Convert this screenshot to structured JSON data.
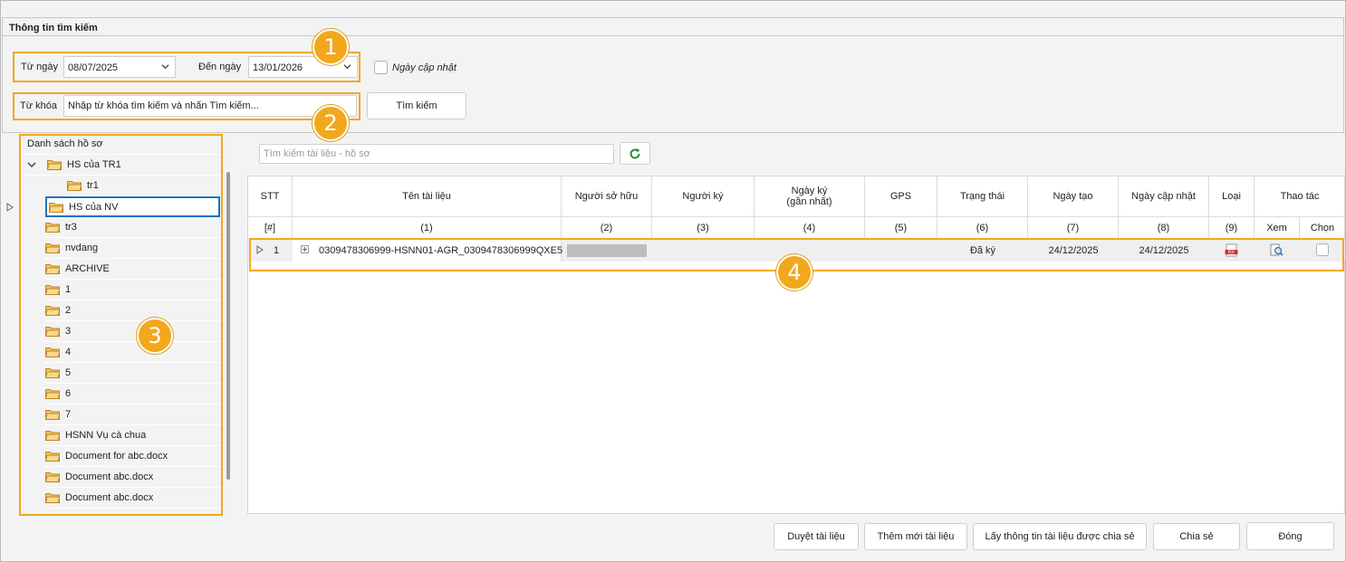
{
  "search": {
    "section_title": "Thông tin tìm kiếm",
    "from_label": "Từ ngày",
    "from_value": "08/07/2025",
    "to_label": "Đến ngày",
    "to_value": "13/01/2026",
    "updated_label": "Ngày cập nhật",
    "keyword_label": "Từ khóa",
    "keyword_placeholder": "Nhập từ khóa tìm kiếm và nhấn Tìm kiếm...",
    "search_button": "Tìm kiếm"
  },
  "tree": {
    "title": "Danh sách hồ sơ",
    "items": [
      {
        "label": "HS của TR1",
        "icon": "folder-open-icon"
      },
      {
        "label": "tr1",
        "icon": "folder-icon"
      },
      {
        "label": "HS của NV",
        "icon": "folder-icon"
      },
      {
        "label": "tr3",
        "icon": "folder-icon"
      },
      {
        "label": "nvdang",
        "icon": "folder-icon"
      },
      {
        "label": "ARCHIVE",
        "icon": "folder-icon"
      },
      {
        "label": "1",
        "icon": "folder-icon"
      },
      {
        "label": "2",
        "icon": "folder-icon"
      },
      {
        "label": "3",
        "icon": "folder-icon"
      },
      {
        "label": "4",
        "icon": "folder-icon"
      },
      {
        "label": "5",
        "icon": "folder-icon"
      },
      {
        "label": "6",
        "icon": "folder-icon"
      },
      {
        "label": "7",
        "icon": "folder-icon"
      },
      {
        "label": "HSNN Vụ cà chua",
        "icon": "folder-icon"
      },
      {
        "label": "Document for abc.docx",
        "icon": "folder-icon"
      },
      {
        "label": "Document abc.docx",
        "icon": "folder-icon"
      },
      {
        "label": "Document abc.docx",
        "icon": "folder-icon"
      }
    ]
  },
  "docs": {
    "search_placeholder": "Tìm kiếm tài liệu - hồ sơ",
    "headers": {
      "stt": "STT",
      "name": "Tên tài liệu",
      "owner": "Người sở hữu",
      "signer": "Người ký",
      "signed_date_1": "Ngày ký",
      "signed_date_2": "(gần nhất)",
      "gps": "GPS",
      "status": "Trạng thái",
      "created": "Ngày tạo",
      "updated": "Ngày cập nhật",
      "type": "Loại",
      "actions": "Thao tác",
      "view": "Xem",
      "select": "Chọn"
    },
    "index_row": [
      "[#]",
      "(1)",
      "(2)",
      "(3)",
      "(4)",
      "(5)",
      "(6)",
      "(7)",
      "(8)",
      "(9)"
    ],
    "rows": [
      {
        "stt": "1",
        "name": "0309478306999-HSNN01-AGR_0309478306999QXE5",
        "status": "Đã ký",
        "created": "24/12/2025",
        "updated": "24/12/2025",
        "type_icon": "pdf-icon",
        "view_icon": "preview-icon"
      }
    ]
  },
  "footer": {
    "approve": "Duyệt tài liệu",
    "add": "Thêm mới tài liệu",
    "shared": "Lấy thông tin tài liệu được chia sẻ",
    "share": "Chia sẻ",
    "close": "Đóng"
  },
  "badges": [
    "1",
    "2",
    "3",
    "4"
  ],
  "colors": {
    "highlight": "#f2a81d",
    "refresh_green": "#2e8b3a"
  }
}
